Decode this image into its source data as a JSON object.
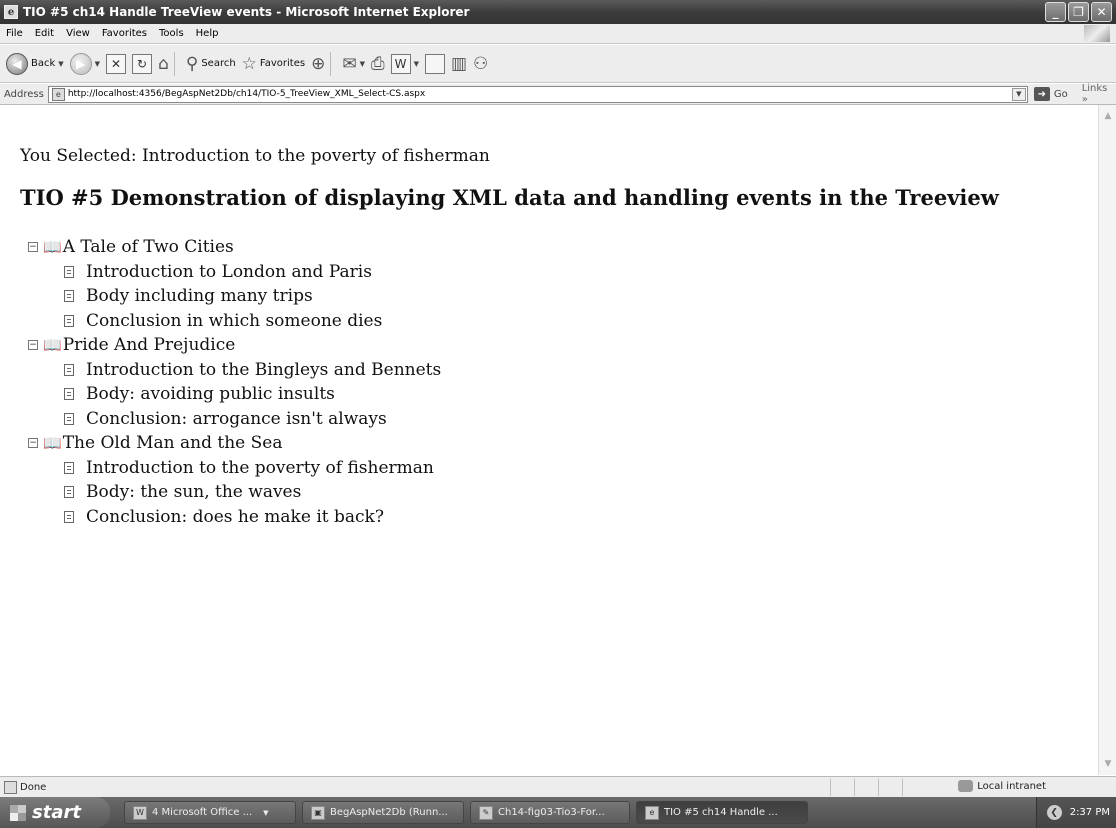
{
  "window": {
    "title": "TIO #5 ch14 Handle TreeView events - Microsoft Internet Explorer",
    "controls": [
      "minimize-icon",
      "restore-icon",
      "close-icon"
    ]
  },
  "menu": [
    "File",
    "Edit",
    "View",
    "Favorites",
    "Tools",
    "Help"
  ],
  "toolbar": {
    "back_label": "Back",
    "search_label": "Search",
    "favorites_label": "Favorites"
  },
  "address": {
    "label": "Address",
    "url": "http://localhost:4356/BegAspNet2Db/ch14/TIO-5_TreeView_XML_Select-CS.aspx",
    "go_label": "Go",
    "links_label": "Links"
  },
  "page": {
    "selected_text": "You Selected: Introduction to the poverty of fisherman",
    "heading": "TIO #5 Demonstration of displaying XML data and handling events in the Treeview"
  },
  "tree": [
    {
      "title": "A Tale of Two Cities",
      "children": [
        "Introduction to London and Paris",
        "Body including many trips",
        "Conclusion in which someone dies"
      ]
    },
    {
      "title": "Pride And Prejudice",
      "children": [
        "Introduction to the Bingleys and Bennets",
        "Body: avoiding public insults",
        "Conclusion: arrogance isn't always"
      ]
    },
    {
      "title": "The Old Man and the Sea",
      "children": [
        "Introduction to the poverty of fisherman",
        "Body: the sun, the waves",
        "Conclusion: does he make it back?"
      ]
    }
  ],
  "status": {
    "text": "Done",
    "zone": "Local intranet"
  },
  "taskbar": {
    "start_label": "start",
    "tasks": [
      "4 Microsoft Office ...",
      "BegAspNet2Db (Runn...",
      "Ch14-fig03-Tio3-For...",
      "TIO #5 ch14 Handle ..."
    ],
    "clock": "2:37 PM"
  }
}
